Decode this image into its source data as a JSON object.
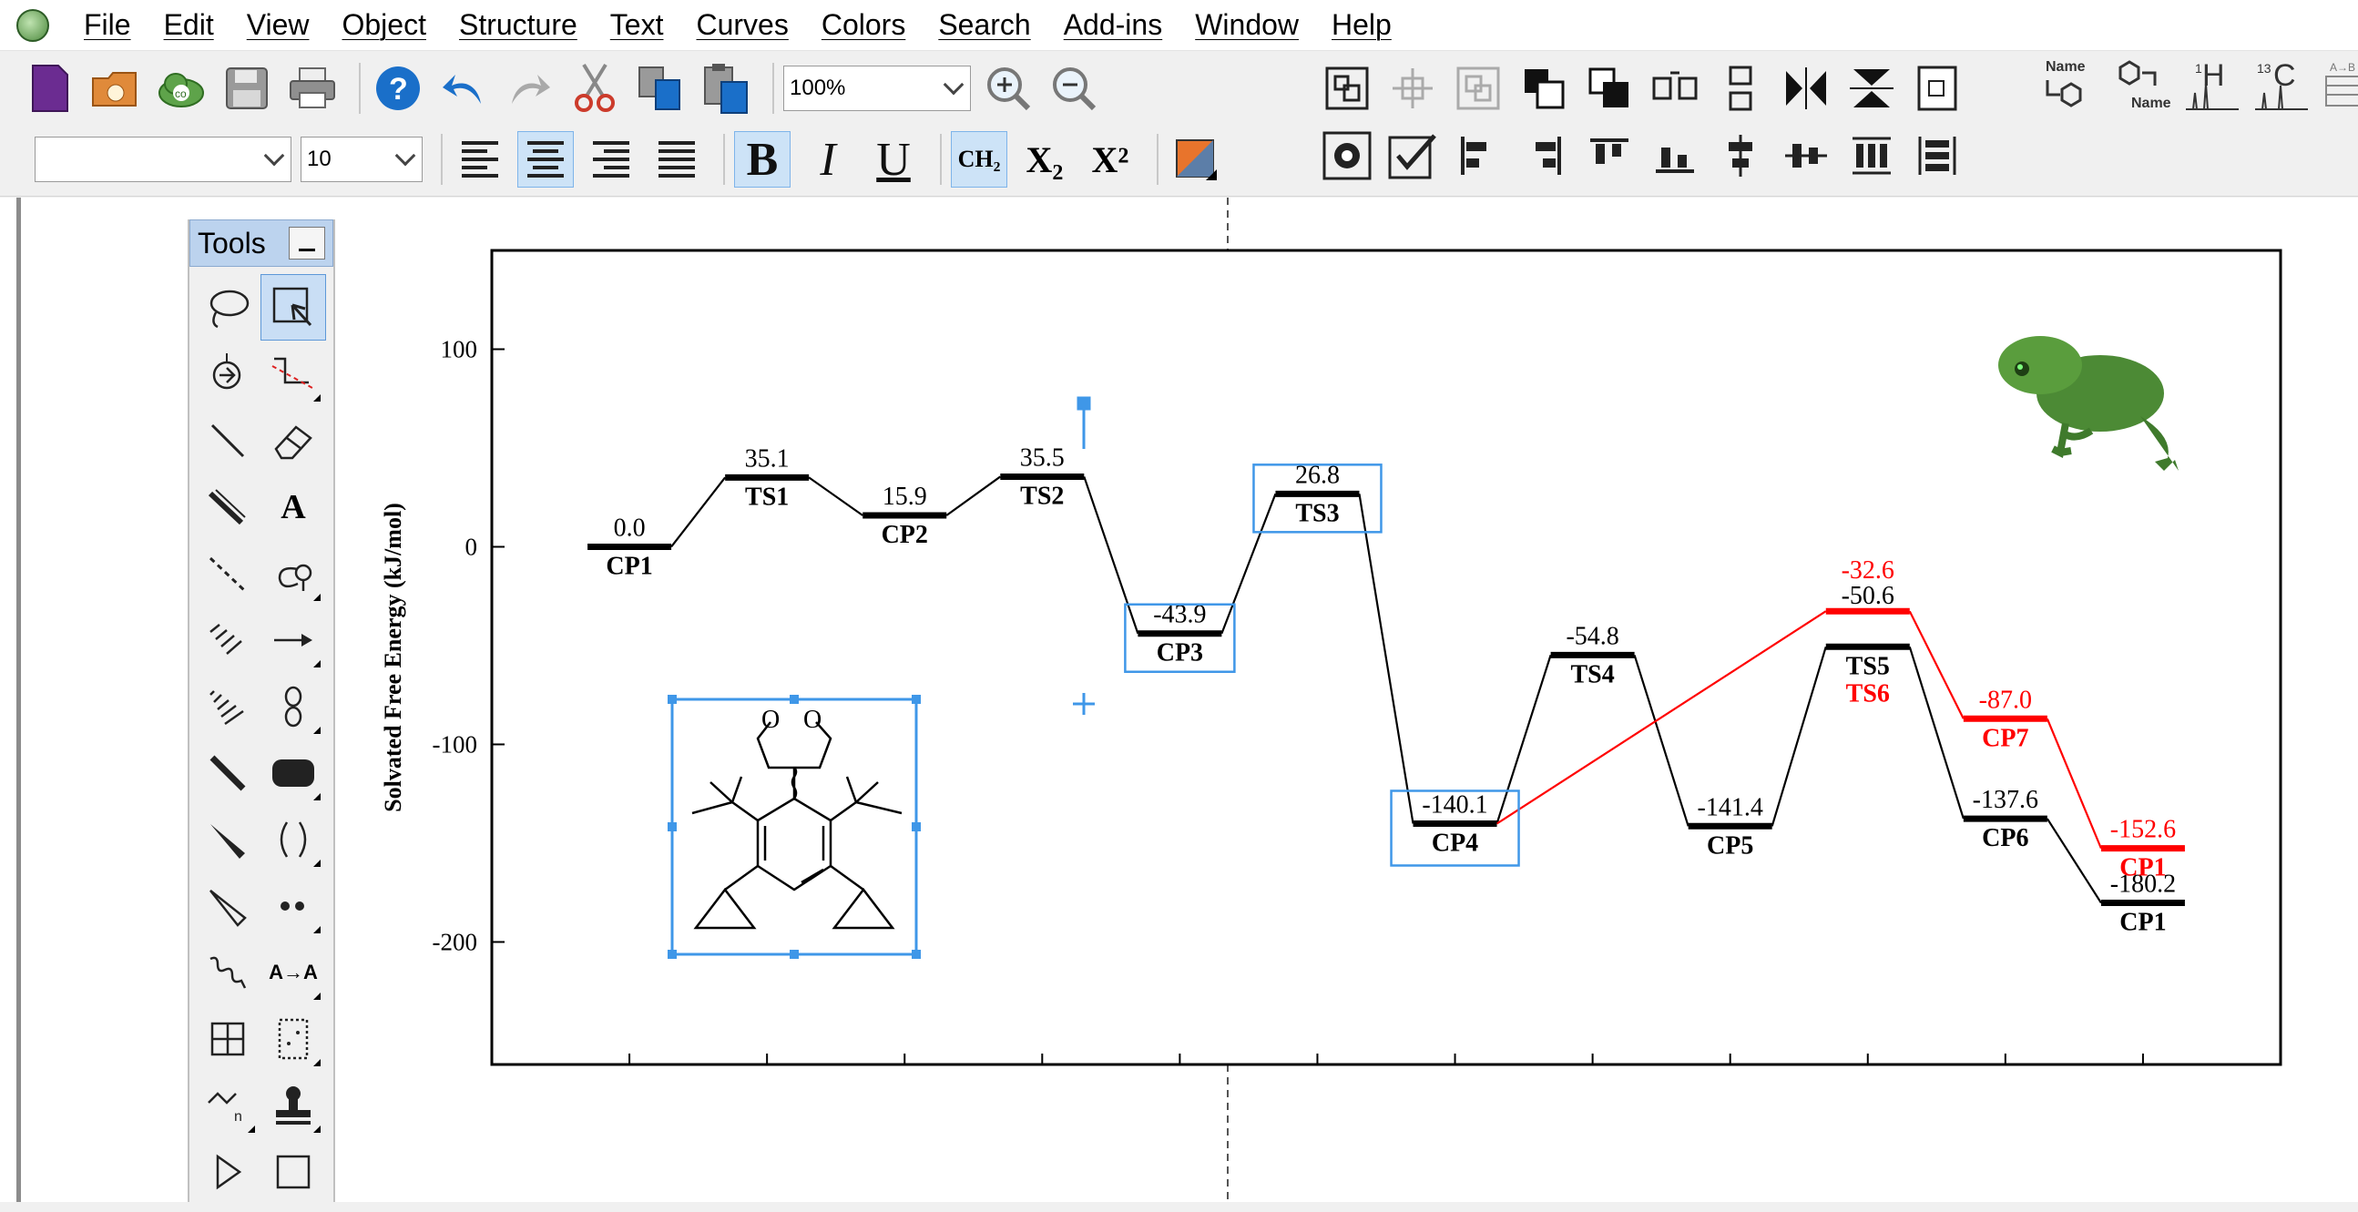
{
  "menu": [
    "File",
    "Edit",
    "View",
    "Object",
    "Structure",
    "Text",
    "Curves",
    "Colors",
    "Search",
    "Add-ins",
    "Window",
    "Help"
  ],
  "toolbar": {
    "zoom_value": "100%",
    "font_name": "",
    "font_size": "10",
    "subscript_sample": "X₂",
    "superscript_sample": "X²",
    "ch2_label": "CH₂",
    "bold_label": "B",
    "italic_label": "I",
    "underline_label": "U",
    "name_to_struct_label": "Name",
    "struct_to_name_label": "Name",
    "h1_label": "1H",
    "c13_label": "13C",
    "ab_label": "A→B"
  },
  "tools_panel": {
    "title": "Tools",
    "text_tool_label": "A",
    "convert_tool_label": "A→A"
  },
  "chart_data": {
    "type": "energy-profile",
    "ylabel": "Solvated Free Energy (kJ/mol)",
    "yticks": [
      "100",
      "0",
      "-100",
      "-200"
    ],
    "ylim": [
      -262,
      150
    ],
    "xlim": [
      0,
      13
    ],
    "levels": [
      {
        "label": "CP1",
        "value": "0.0",
        "y": 0.0,
        "x": 1,
        "color": "#000000"
      },
      {
        "label": "TS1",
        "value": "35.1",
        "y": 35.1,
        "x": 2,
        "color": "#000000"
      },
      {
        "label": "CP2",
        "value": "15.9",
        "y": 15.9,
        "x": 3,
        "color": "#000000"
      },
      {
        "label": "TS2",
        "value": "35.5",
        "y": 35.5,
        "x": 4,
        "color": "#000000"
      },
      {
        "label": "CP3",
        "value": "-43.9",
        "y": -43.9,
        "x": 5,
        "color": "#000000"
      },
      {
        "label": "TS3",
        "value": "26.8",
        "y": 26.8,
        "x": 6,
        "color": "#000000"
      },
      {
        "label": "CP4",
        "value": "-140.1",
        "y": -140.1,
        "x": 7,
        "color": "#000000"
      },
      {
        "label": "TS4",
        "value": "-54.8",
        "y": -54.8,
        "x": 8,
        "color": "#000000"
      },
      {
        "label": "CP5",
        "value": "-141.4",
        "y": -141.4,
        "x": 9,
        "color": "#000000"
      },
      {
        "label": "TS5",
        "value": "-50.6",
        "y": -50.6,
        "x": 10,
        "color": "#000000"
      },
      {
        "label": "CP6",
        "value": "-137.6",
        "y": -137.6,
        "x": 11,
        "color": "#000000"
      },
      {
        "label": "CP1",
        "value": "-180.2",
        "y": -180.2,
        "x": 12,
        "color": "#000000"
      },
      {
        "label": "TS6",
        "value": "-32.6",
        "y": -32.6,
        "x": 10,
        "color": "#ff0000"
      },
      {
        "label": "CP7",
        "value": "-87.0",
        "y": -87.0,
        "x": 11,
        "color": "#ff0000"
      },
      {
        "label": "CP1",
        "value": "-152.6",
        "y": -152.6,
        "x": 12,
        "color": "#ff0000"
      }
    ],
    "black_path": [
      "CP1",
      "TS1",
      "CP2",
      "TS2",
      "CP3",
      "TS3",
      "CP4",
      "TS4",
      "CP5",
      "TS5",
      "CP6",
      "CP1"
    ],
    "red_path": [
      6,
      12,
      13,
      14
    ],
    "molecule_atoms": [
      "O",
      "O"
    ]
  },
  "colors": {
    "selection": "#3f97e8",
    "red_pathway": "#ff0000",
    "menu_bg": "#ffffff",
    "toolbar_bg": "#f0f0f0",
    "tools_title_bg": "#bcd3ee"
  }
}
